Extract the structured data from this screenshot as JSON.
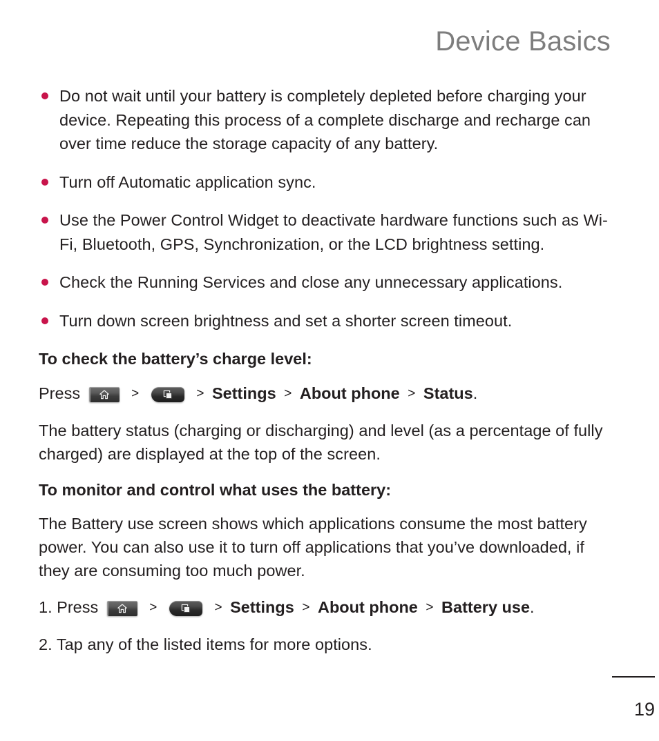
{
  "header": {
    "chapter_title": "Device Basics"
  },
  "tips": {
    "bullets": [
      "Do not wait until your battery is completely depleted before charging your device. Repeating this process of a complete discharge and recharge can over time reduce the storage capacity of any battery.",
      "Turn off Automatic application sync.",
      "Use the Power Control Widget to deactivate hardware functions such as Wi-Fi, Bluetooth, GPS, Synchronization, or the LCD brightness setting.",
      "Check the Running Services and close any unnecessary applications.",
      "Turn down screen brightness and set a shorter screen timeout."
    ]
  },
  "section_charge_level": {
    "heading": "To check the battery’s charge level:",
    "press_label": "Press",
    "separator": ">",
    "home_key_icon": "home-key-icon",
    "menu_key_icon": "menu-key-icon",
    "path": [
      "Settings",
      "About phone",
      "Status"
    ],
    "path_terminator": ".",
    "body": "The battery status (charging or discharging) and level (as a percentage of fully charged) are displayed at the top of the screen."
  },
  "section_monitor": {
    "heading": "To monitor and control what uses the battery:",
    "body": "The Battery use screen shows which applications consume the most battery power. You can also use it to turn off applications that you’ve downloaded, if they are consuming too much power.",
    "steps": [
      {
        "number": "1.",
        "press_label": "Press",
        "separator": ">",
        "home_key_icon": "home-key-icon",
        "menu_key_icon": "menu-key-icon",
        "path": [
          "Settings",
          "About phone",
          "Battery use"
        ],
        "path_terminator": "."
      },
      {
        "number": "2.",
        "text": "Tap any of the listed items for more options."
      }
    ]
  },
  "footer": {
    "page_number": "19"
  },
  "colors": {
    "bullet": "#c8144b",
    "header_gray": "#7d7d7d",
    "text": "#231f20"
  }
}
